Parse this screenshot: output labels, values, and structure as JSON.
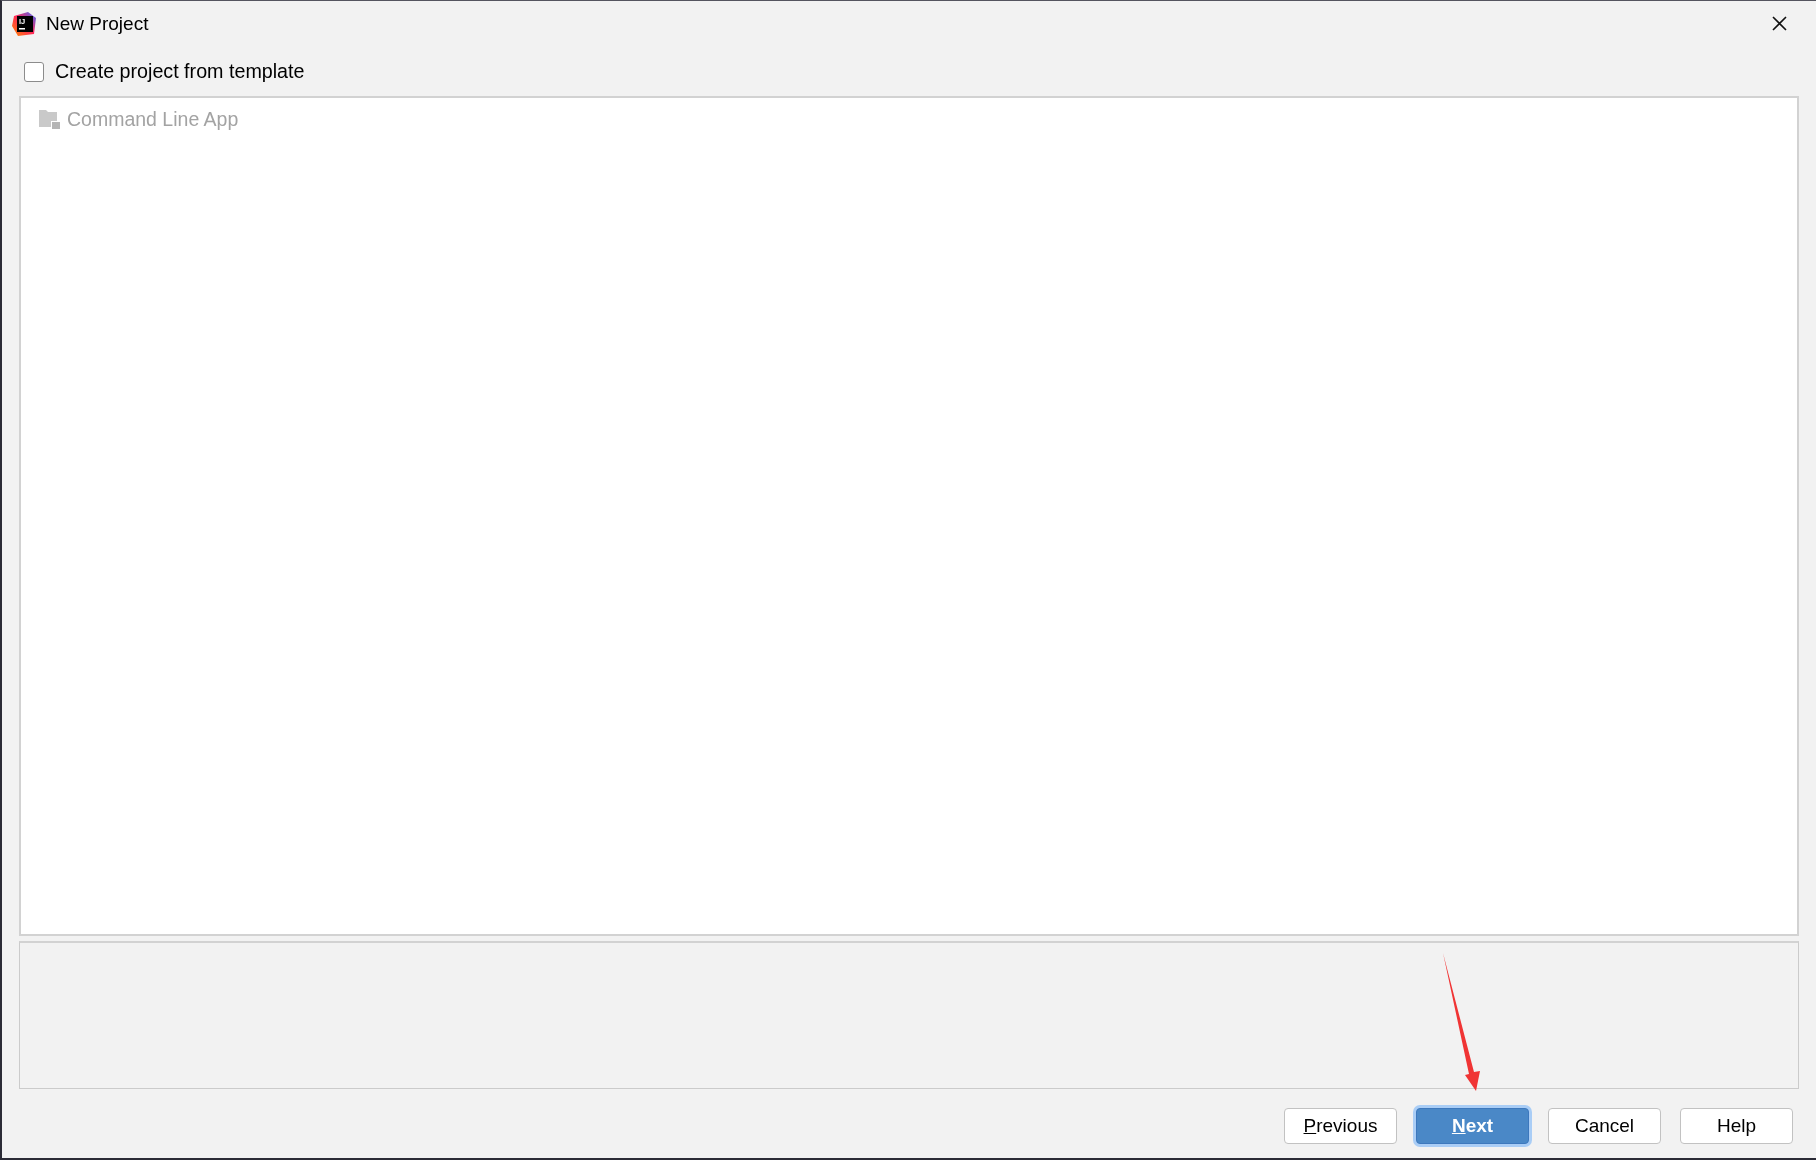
{
  "window": {
    "title": "New Project",
    "logo_text": "IJ"
  },
  "template_checkbox": {
    "label": "Create project from template",
    "checked": false
  },
  "template_list": {
    "items": [
      {
        "label": "Command Line App",
        "disabled": true
      }
    ]
  },
  "buttons": [
    {
      "label": "Previous",
      "mnemonic": true,
      "primary": false
    },
    {
      "label": "Next",
      "mnemonic": true,
      "primary": true
    },
    {
      "label": "Cancel",
      "mnemonic": false,
      "primary": false
    },
    {
      "label": "Help",
      "mnemonic": false,
      "primary": false
    }
  ]
}
